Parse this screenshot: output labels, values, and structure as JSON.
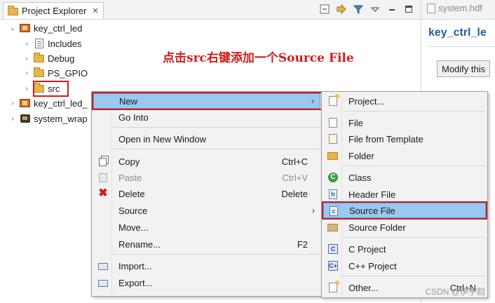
{
  "project_explorer": {
    "tab_label": "Project Explorer",
    "close_glyph": "✕",
    "toolbar_icons": [
      "collapse-all-icon",
      "link-with-editor-icon",
      "filter-icon",
      "view-menu-icon",
      "minimize-icon",
      "maximize-icon"
    ],
    "tree": [
      {
        "label": "key_ctrl_led",
        "expanded": true,
        "icon": "project-icon",
        "level": 0
      },
      {
        "label": "Includes",
        "expanded": false,
        "icon": "includes-icon",
        "level": 1
      },
      {
        "label": "Debug",
        "expanded": false,
        "icon": "folder-icon",
        "level": 1
      },
      {
        "label": "PS_GPIO",
        "expanded": false,
        "icon": "folder-icon",
        "level": 1
      },
      {
        "label": "src",
        "expanded": false,
        "icon": "folder-icon",
        "level": 1
      },
      {
        "label": "key_ctrl_led_",
        "expanded": false,
        "icon": "project-icon",
        "level": 0
      },
      {
        "label": "system_wrap",
        "expanded": false,
        "icon": "chip-icon",
        "level": 0
      }
    ]
  },
  "annotation": "点击src右键添加一个Source File",
  "editor": {
    "tab_label": "system.hdf",
    "title": "key_ctrl_le",
    "button_label": "Modify this"
  },
  "context_menu": {
    "items": [
      {
        "label": "New",
        "submenu": true,
        "highlighted": true
      },
      {
        "label": "Go Into"
      },
      {
        "label": "Open in New Window"
      },
      {
        "label": "Copy",
        "shortcut": "Ctrl+C",
        "icon": "copy-icon"
      },
      {
        "label": "Paste",
        "shortcut": "Ctrl+V",
        "icon": "paste-icon",
        "disabled": true
      },
      {
        "label": "Delete",
        "shortcut": "Delete",
        "icon": "delete-icon"
      },
      {
        "label": "Source",
        "submenu": true
      },
      {
        "label": "Move..."
      },
      {
        "label": "Rename...",
        "shortcut": "F2"
      },
      {
        "label": "Import...",
        "icon": "import-icon"
      },
      {
        "label": "Export...",
        "icon": "export-icon"
      }
    ]
  },
  "new_submenu": {
    "items": [
      {
        "label": "Project...",
        "icon": "new-project-icon"
      },
      {
        "label": "File",
        "icon": "file-icon"
      },
      {
        "label": "File from Template",
        "icon": "file-template-icon"
      },
      {
        "label": "Folder",
        "icon": "folder-icon"
      },
      {
        "label": "Class",
        "icon": "class-icon"
      },
      {
        "label": "Header File",
        "icon": "header-file-icon"
      },
      {
        "label": "Source File",
        "icon": "source-file-icon",
        "highlighted": true
      },
      {
        "label": "Source Folder",
        "icon": "source-folder-icon"
      },
      {
        "label": "C Project",
        "icon": "c-project-icon"
      },
      {
        "label": "C++ Project",
        "icon": "cpp-project-icon"
      },
      {
        "label": "Other...",
        "shortcut": "Ctrl+N",
        "icon": "other-icon"
      }
    ]
  },
  "watermark": "CSDN @伊宇韵",
  "colors": {
    "highlight": "#99c9ef",
    "highlight_border": "#5a9be0",
    "annotation_red": "#d21b1b",
    "editor_title_blue": "#1f5fa8"
  }
}
